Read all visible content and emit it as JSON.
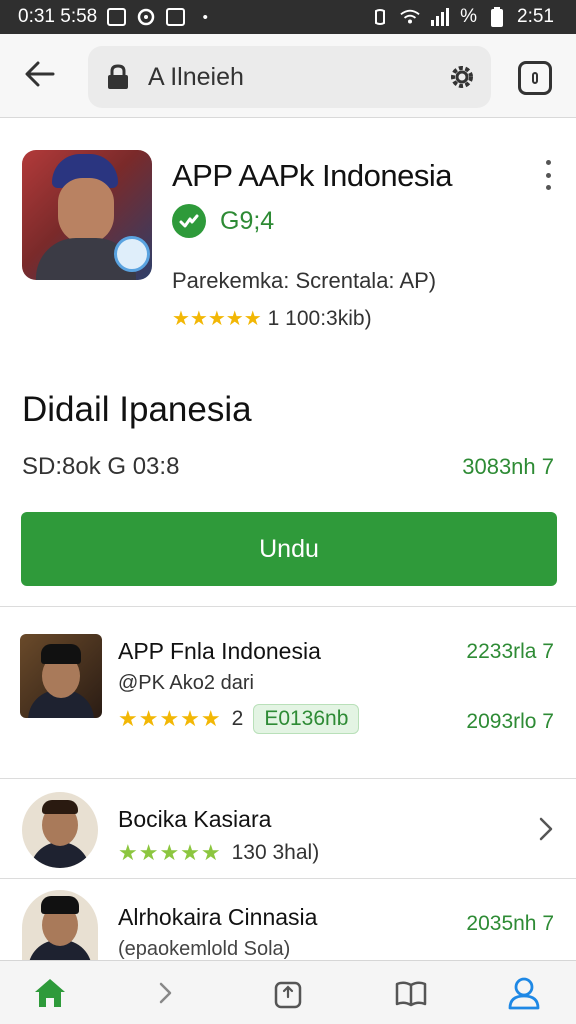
{
  "status_bar": {
    "time_left": "0:31 5:58",
    "time_right": "2:51",
    "battery_text": "%"
  },
  "toolbar": {
    "address": "A  Ilneieh"
  },
  "app": {
    "title": "APP AAPk Indonesia",
    "verified_text": "G9;4",
    "publisher": "Parekemka: Screntala: AP)",
    "rating_stars": "★★★★★",
    "rating_text": "1 100:3kib)"
  },
  "detail": {
    "title": "Didail Ipanesia",
    "left": "SD:8ok G 03:8",
    "right": "3083nh 7"
  },
  "download": {
    "label": "Undu"
  },
  "list": [
    {
      "title": "APP Fnla Indonesia",
      "subtitle": "@PK Ako2 dari",
      "stars": "★★★★★",
      "rating_count": "2",
      "size_badge": "E0136nb",
      "right_top": "2233rla 7",
      "right_bottom": "2093rlo 7"
    },
    {
      "title": "Bocika Kasiara",
      "stars": "★★★★★",
      "rating_text": "130 3hal)"
    },
    {
      "title": "Alrhokaira Cinnasia",
      "subtitle": "(epaokemlold Sola)",
      "right": "2035nh 7"
    }
  ],
  "colors": {
    "accent_green": "#2f9a3a",
    "status_bar": "#2f2f2f",
    "star_gold": "#f2b705",
    "star_green": "#8cc63f"
  }
}
